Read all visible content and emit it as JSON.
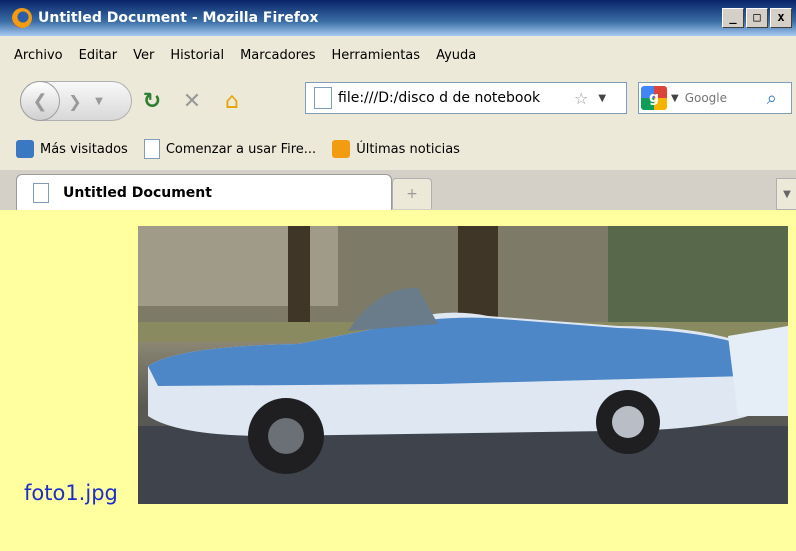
{
  "window": {
    "title": "Untitled Document - Mozilla Firefox",
    "controls": [
      "_",
      "□",
      "x"
    ]
  },
  "menu": [
    "Archivo",
    "Editar",
    "Ver",
    "Historial",
    "Marcadores",
    "Herramientas",
    "Ayuda"
  ],
  "nav": {
    "url": "file:///D:/disco d de notebook",
    "search_placeholder": "Google"
  },
  "bookmarks": [
    {
      "label": "Más visitados",
      "icon": "most-visited-icon"
    },
    {
      "label": "Comenzar a usar Fire...",
      "icon": "page-icon"
    },
    {
      "label": "Últimas noticias",
      "icon": "rss-icon"
    }
  ],
  "tabs": [
    {
      "title": "Untitled Document",
      "active": true
    }
  ],
  "content": {
    "image_label": "foto1.jpg",
    "background_color": "#ffffa0",
    "label_color": "#1f2ec9"
  }
}
